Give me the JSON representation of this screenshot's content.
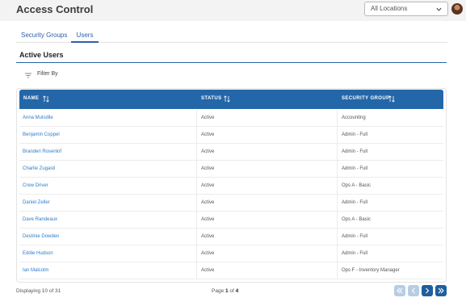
{
  "header": {
    "title": "Access Control",
    "location_select": {
      "selected": "All Locations"
    }
  },
  "tabs": [
    {
      "label": "Security Groups",
      "active": false
    },
    {
      "label": "Users",
      "active": true
    }
  ],
  "section": {
    "title": "Active Users"
  },
  "filter": {
    "label": "Filter By"
  },
  "table": {
    "columns": [
      "NAME",
      "STATUS",
      "SECURITY GROUP"
    ],
    "rows": [
      {
        "name": "Anna Mulsdile",
        "status": "Active",
        "group": "Accounting"
      },
      {
        "name": "Benjamin Coppel",
        "status": "Active",
        "group": "Admin - Full"
      },
      {
        "name": "Branderi Rosenlof",
        "status": "Active",
        "group": "Admin - Full"
      },
      {
        "name": "Charlie Zugasti",
        "status": "Active",
        "group": "Admin - Full"
      },
      {
        "name": "Crew Driver",
        "status": "Active",
        "group": "Ops A - Basic"
      },
      {
        "name": "Daniel Zeller",
        "status": "Active",
        "group": "Admin - Full"
      },
      {
        "name": "Dave Randeaux",
        "status": "Active",
        "group": "Ops A - Basic"
      },
      {
        "name": "Destinie Dowden",
        "status": "Active",
        "group": "Admin - Full"
      },
      {
        "name": "Eddie Hudson",
        "status": "Active",
        "group": "Admin - Full"
      },
      {
        "name": "Ian Malcolm",
        "status": "Active",
        "group": "Ops F - Inventory Manager"
      }
    ]
  },
  "footer": {
    "displaying": "Displaying 10 of 31",
    "page_prefix": "Page ",
    "page_current": "1",
    "page_of": " of ",
    "page_total": "4"
  },
  "colors": {
    "header_blue": "#2467a8",
    "link_blue": "#2f7cc9",
    "pager_active": "#1f5f9e",
    "pager_disabled": "#b8cde3"
  }
}
